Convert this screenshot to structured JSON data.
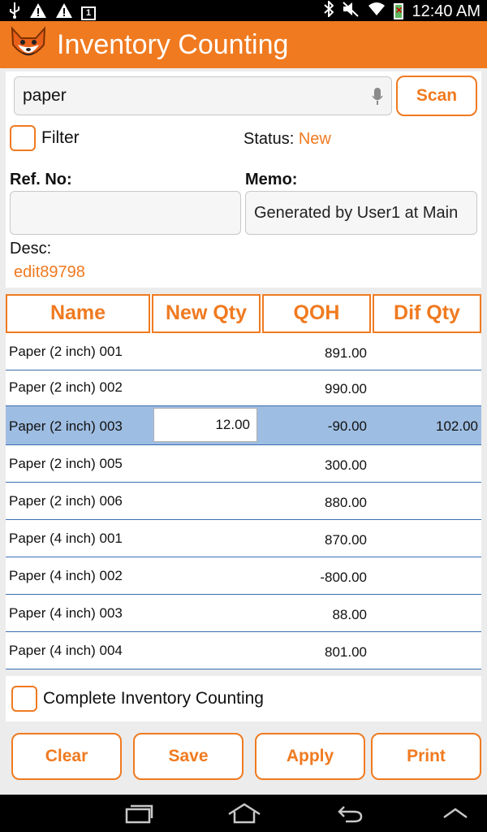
{
  "status_bar": {
    "time": "12:40 AM",
    "left_icons": [
      "usb-icon",
      "warning-icon",
      "warning-icon",
      "notification-1-icon"
    ],
    "right_icons": [
      "bluetooth-icon",
      "mute-icon",
      "wifi-icon",
      "battery-icon"
    ],
    "notification_count": "1"
  },
  "header": {
    "title": "Inventory Counting",
    "logo_icon": "fox-logo-icon"
  },
  "search": {
    "value": "paper",
    "scan_label": "Scan"
  },
  "filter": {
    "label": "Filter",
    "checked": false
  },
  "status": {
    "label": "Status:",
    "value": "New"
  },
  "ref": {
    "label": "Ref. No:",
    "value": ""
  },
  "memo": {
    "label": "Memo:",
    "value": "Generated by User1 at Main"
  },
  "desc": {
    "label": "Desc:",
    "value": "edit89798"
  },
  "table": {
    "columns": [
      "Name",
      "New Qty",
      "QOH",
      "Dif Qty"
    ],
    "rows": [
      {
        "name": "Paper (2 inch) 001",
        "new_qty": "",
        "qoh": "891.00",
        "dif_qty": ""
      },
      {
        "name": "Paper (2 inch) 002",
        "new_qty": "",
        "qoh": "990.00",
        "dif_qty": ""
      },
      {
        "name": "Paper (2 inch) 003",
        "new_qty": "12.00",
        "qoh": "-90.00",
        "dif_qty": "102.00"
      },
      {
        "name": "Paper (2 inch) 005",
        "new_qty": "",
        "qoh": "300.00",
        "dif_qty": ""
      },
      {
        "name": "Paper (2 inch) 006",
        "new_qty": "",
        "qoh": "880.00",
        "dif_qty": ""
      },
      {
        "name": "Paper (4 inch) 001",
        "new_qty": "",
        "qoh": "870.00",
        "dif_qty": ""
      },
      {
        "name": "Paper (4 inch) 002",
        "new_qty": "",
        "qoh": "-800.00",
        "dif_qty": ""
      },
      {
        "name": "Paper (4 inch) 003",
        "new_qty": "",
        "qoh": "88.00",
        "dif_qty": ""
      },
      {
        "name": "Paper (4 inch) 004",
        "new_qty": "",
        "qoh": "801.00",
        "dif_qty": ""
      }
    ]
  },
  "complete": {
    "label": "Complete Inventory Counting",
    "checked": false
  },
  "buttons": {
    "clear": "Clear",
    "save": "Save",
    "apply": "Apply",
    "print": "Print"
  },
  "colors": {
    "accent": "#f07a20",
    "selected_row": "#9ebde2",
    "row_divider": "#3b6eb0"
  }
}
